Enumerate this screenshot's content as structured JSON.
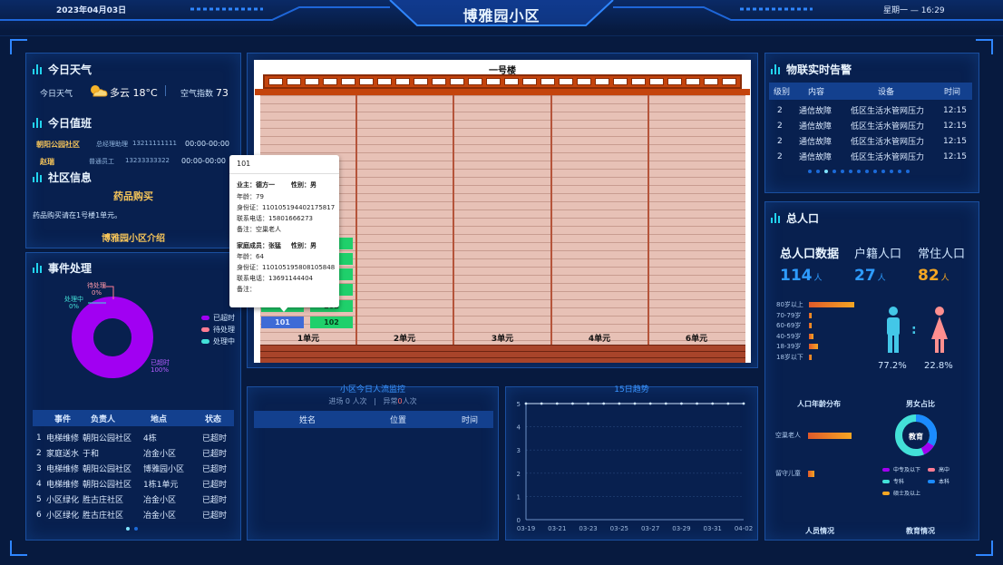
{
  "header": {
    "date": "2023年04月03日",
    "title": "博雅园小区",
    "weekday_time": "星期一 — 16:29"
  },
  "weather": {
    "panel_title": "今日天气",
    "label": "今日天气",
    "condition": "多云",
    "temperature": "18°C",
    "air_label": "空气指数",
    "air_value": "73"
  },
  "duty": {
    "panel_title": "今日值班",
    "rows": [
      {
        "name": "朝阳公园社区",
        "role": "总经理助理",
        "phone": "13211111111",
        "time": "00:00-00:00"
      },
      {
        "name": "赵瑞",
        "role": "普通员工",
        "phone": "13233333322",
        "time": "00:00-00:00"
      }
    ]
  },
  "community": {
    "panel_title": "社区信息",
    "heading": "药品购买",
    "text": "药品购买请在1号楼1单元。",
    "intro_link": "博雅园小区介绍"
  },
  "events": {
    "panel_title": "事件处理",
    "donut_labels": {
      "pending": "待处理",
      "pending_pct": "0%",
      "processing": "处理中",
      "processing_pct": "0%",
      "timeout": "已超时",
      "timeout_pct": "100%"
    },
    "legend": [
      {
        "label": "已超时",
        "color": "#a100f2"
      },
      {
        "label": "待处理",
        "color": "#ff7c93"
      },
      {
        "label": "处理中",
        "color": "#43e1d8"
      }
    ],
    "columns": [
      "事件",
      "负责人",
      "地点",
      "状态"
    ],
    "rows": [
      {
        "idx": "1",
        "event": "电梯维修",
        "person": "朝阳公园社区",
        "place": "4栋",
        "status": "已超时"
      },
      {
        "idx": "2",
        "event": "家庭送水",
        "person": "于和",
        "place": "冶金小区",
        "status": "已超时"
      },
      {
        "idx": "3",
        "event": "电梯维修",
        "person": "朝阳公园社区",
        "place": "博雅园小区",
        "status": "已超时"
      },
      {
        "idx": "4",
        "event": "电梯维修",
        "person": "朝阳公园社区",
        "place": "1栋1单元",
        "status": "已超时"
      },
      {
        "idx": "5",
        "event": "小区绿化",
        "person": "胜古庄社区",
        "place": "冶金小区",
        "status": "已超时"
      },
      {
        "idx": "6",
        "event": "小区绿化",
        "person": "胜古庄社区",
        "place": "冶金小区",
        "status": "已超时"
      }
    ]
  },
  "building": {
    "name": "一号楼",
    "units": [
      "1单元",
      "2单元",
      "3单元",
      "4单元",
      "6单元"
    ],
    "rooms": [
      {
        "left": "2",
        "right": "202"
      },
      {
        "left": "101",
        "right": "102"
      }
    ],
    "tooltip": {
      "room": "101",
      "owner_label": "业主：",
      "owner": "德方一",
      "gender_label": "性别：",
      "gender": "男",
      "age_label": "年龄：",
      "age": "79",
      "id_label": "身份证：",
      "id": "110105194402175817",
      "phone_label": "联系电话：",
      "phone": "15801666273",
      "note_label": "备注：",
      "note": "空巢老人",
      "member_label": "家庭成员：",
      "member": "张猛",
      "member_gender_label": "性别：",
      "member_gender": "男",
      "member_age_label": "年龄：",
      "member_age": "64",
      "member_id_label": "身份证：",
      "member_id": "110105195808105848",
      "member_phone_label": "联系电话：",
      "member_phone": "13691144404",
      "member_note_label": "备注：",
      "member_note": ""
    }
  },
  "flow": {
    "title": "小区今日人流监控",
    "in_label": "进场",
    "in_value": "0",
    "in_unit": "人次",
    "abn_label": "异常",
    "abn_value": "0",
    "abn_unit": "人次",
    "columns": [
      "姓名",
      "位置",
      "时间"
    ]
  },
  "trend": {
    "title": "15日趋势"
  },
  "chart_data": {
    "type": "line",
    "x": [
      "03-19",
      "03-20",
      "03-21",
      "03-22",
      "03-23",
      "03-24",
      "03-25",
      "03-26",
      "03-27",
      "03-28",
      "03-29",
      "03-30",
      "03-31",
      "04-01",
      "04-02"
    ],
    "x_tick_labels": [
      "03-19",
      "03-21",
      "03-23",
      "03-25",
      "03-27",
      "03-29",
      "03-31",
      "04-02"
    ],
    "series": [
      {
        "values": [
          5,
          5,
          5,
          5,
          5,
          5,
          5,
          5,
          5,
          5,
          5,
          5,
          5,
          5,
          5
        ],
        "color": "#cfe6ff"
      }
    ],
    "ylim": [
      0,
      5
    ],
    "y_ticks": [
      "0",
      "1",
      "2",
      "3",
      "4",
      "5"
    ],
    "grid": true
  },
  "iot": {
    "panel_title": "物联实时告警",
    "columns": [
      "级别",
      "内容",
      "设备",
      "时间"
    ],
    "rows": [
      {
        "level": "2",
        "content": "通信故障",
        "device": "低区生活水管网压力",
        "time": "12:15"
      },
      {
        "level": "2",
        "content": "通信故障",
        "device": "低区生活水管网压力",
        "time": "12:15"
      },
      {
        "level": "2",
        "content": "通信故障",
        "device": "低区生活水管网压力",
        "time": "12:15"
      },
      {
        "level": "2",
        "content": "通信故障",
        "device": "低区生活水管网压力",
        "time": "12:15"
      }
    ]
  },
  "population": {
    "panel_title": "总人口",
    "labels": {
      "total": "总人口数据",
      "registered": "户籍人口",
      "resident": "常住人口"
    },
    "values": {
      "total": "114",
      "registered": "27",
      "resident": "82"
    },
    "unit": "人",
    "age_bars": [
      {
        "label": "80岁以上",
        "value": 0.75
      },
      {
        "label": "70-79岁",
        "value": 0.05
      },
      {
        "label": "60-69岁",
        "value": 0.05
      },
      {
        "label": "40-59岁",
        "value": 0.08
      },
      {
        "label": "18-39岁",
        "value": 0.15
      },
      {
        "label": "18岁以下",
        "value": 0.03
      }
    ],
    "male_pct": "77.2%",
    "female_pct": "22.8%",
    "age_dist_title": "人口年龄分布",
    "gender_title": "男女占比",
    "groups": [
      {
        "label": "空巢老人",
        "value": 0.8
      },
      {
        "label": "留守儿童",
        "value": 0.12
      }
    ],
    "edu_center": "教育",
    "edu_legend": [
      {
        "label": "中专及以下",
        "color": "#a100f2"
      },
      {
        "label": "高中",
        "color": "#ff7c93"
      },
      {
        "label": "专科",
        "color": "#43e1d8"
      },
      {
        "label": "本科",
        "color": "#1b8bff"
      },
      {
        "label": "硕士及以上",
        "color": "#f5a623"
      }
    ],
    "footer_left": "人员情况",
    "footer_right": "教育情况"
  }
}
